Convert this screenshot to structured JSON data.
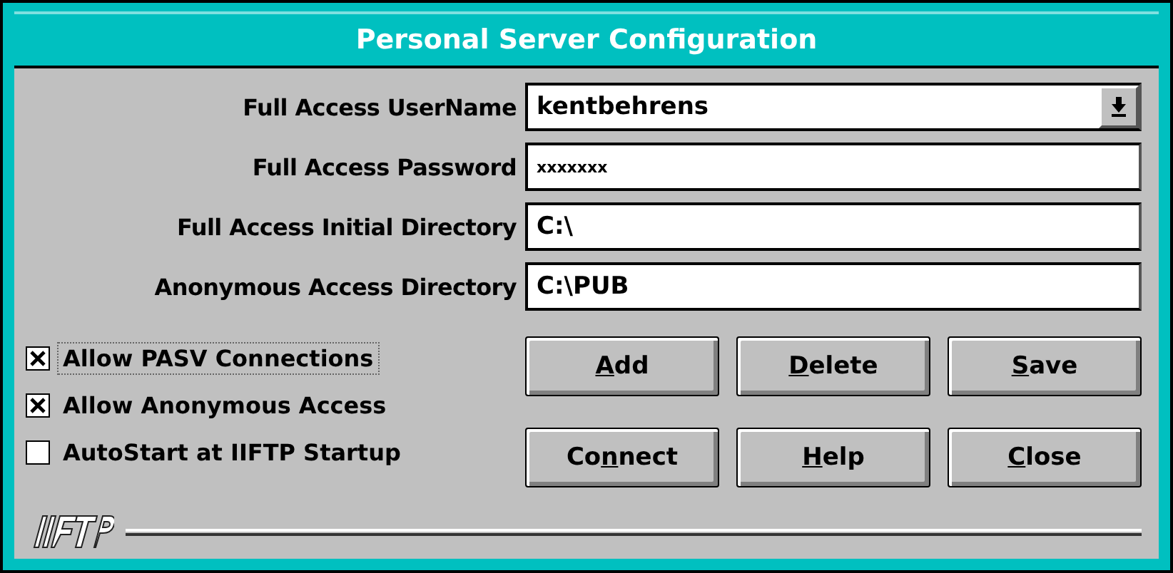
{
  "window": {
    "title": "Personal Server Configuration"
  },
  "fields": [
    {
      "label": "Full Access UserName",
      "value": "kentbehrens",
      "kind": "combo"
    },
    {
      "label": "Full Access Password",
      "value": "xxxxxxx",
      "kind": "password"
    },
    {
      "label": "Full Access Initial Directory",
      "value": "C:\\",
      "kind": "text"
    },
    {
      "label": "Anonymous Access Directory",
      "value": "C:\\PUB",
      "kind": "text"
    }
  ],
  "checkboxes": [
    {
      "label": "Allow PASV Connections",
      "checked": true,
      "focused": true
    },
    {
      "label": "Allow Anonymous Access",
      "checked": true,
      "focused": false
    },
    {
      "label": "AutoStart at IIFTP Startup",
      "checked": false,
      "focused": false
    }
  ],
  "buttons": [
    {
      "key": "A",
      "rest": "dd"
    },
    {
      "key": "D",
      "rest": "elete"
    },
    {
      "key": "S",
      "rest": "ave"
    },
    {
      "lead": "Co",
      "key": "n",
      "rest": "nect"
    },
    {
      "key": "H",
      "rest": "elp"
    },
    {
      "key": "C",
      "rest": "lose"
    }
  ]
}
